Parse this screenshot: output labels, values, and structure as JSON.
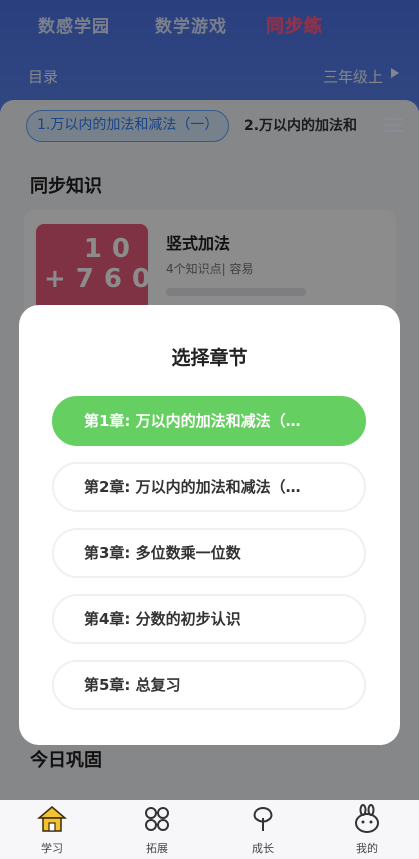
{
  "header": {
    "tabs": [
      "数感学园",
      "数学游戏",
      "同步练"
    ],
    "catalog_label": "目录",
    "grade_label": "三年级上"
  },
  "chapter_tabs": {
    "active": "1.万以内的加法和减法（一）",
    "next": "2.万以内的加法和"
  },
  "sync_section": {
    "title": "同步知识",
    "lesson": {
      "name": "竖式加法",
      "meta": "4个知识点| 容易",
      "thumb_line1": "10",
      "thumb_line2": "+760"
    }
  },
  "bottom_section_title": "今日巩固",
  "modal": {
    "title": "选择章节",
    "chapters": [
      "第1章: 万以内的加法和减法（…",
      "第2章: 万以内的加法和减法（…",
      "第3章: 多位数乘一位数",
      "第4章: 分数的初步认识",
      "第5章: 总复习"
    ],
    "selected_index": 0,
    "selected_color": "#66cf62"
  },
  "bottom_nav": {
    "items": [
      {
        "label": "学习",
        "icon": "house-icon"
      },
      {
        "label": "拓展",
        "icon": "grid-icon"
      },
      {
        "label": "成长",
        "icon": "tree-icon"
      },
      {
        "label": "我的",
        "icon": "bunny-icon"
      }
    ]
  },
  "colors": {
    "header_blue": "#4d73e6",
    "tab_active_blue": "#2f7cf6",
    "thumb_red": "#e65b7a"
  }
}
